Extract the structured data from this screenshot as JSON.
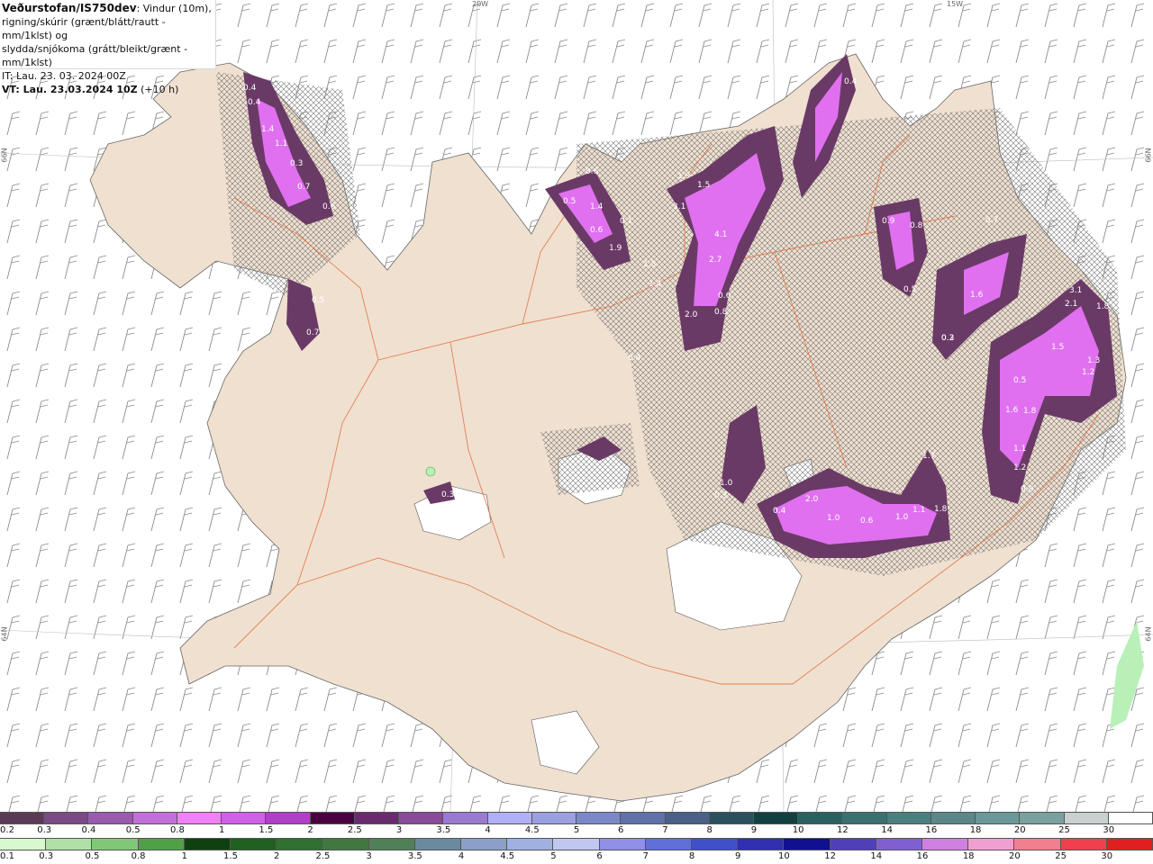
{
  "header": {
    "title": "Veðurstofan/IS750dev",
    "desc_line1": ": Vindur (10m),",
    "desc_line2": "rigning/skúrir (grænt/blátt/rautt - mm/1klst) og",
    "desc_line3": "slydda/snjókoma (grátt/bleikt/grænt - mm/1klst)",
    "it_line": "IT: Lau. 23. 03. 2024 00Z",
    "vt_bold": "VT: Lau. 23.03.2024 10Z",
    "vt_offset": " (+10 h)"
  },
  "grid_labels": {
    "top_20w": "20W",
    "top_15w": "15W",
    "left_66n": "66N",
    "left_64n": "64N",
    "right_66n": "66N",
    "right_64n": "64N"
  },
  "colors": {
    "land": "#f0e0d0",
    "glacier": "#ffffff",
    "roads": "#e07040",
    "snow_dark": "#6a3a66",
    "snow_mid": "#a050b0",
    "snow_light": "#e070f0",
    "rain_light": "#b8f0b8"
  },
  "precip_labels": [
    "0.4",
    "0.4",
    "1.4",
    "1.1",
    "0.3",
    "0.7",
    "0.6",
    "0.5",
    "0.7",
    "0.3",
    "0.6",
    "0.5",
    "1.4",
    "0.6",
    "1.9",
    "0.1",
    "1.5",
    "1.4",
    "0.4",
    "0.4",
    "1.5",
    "1.9",
    "1.5",
    "3.1",
    "4.1",
    "2.7",
    "0.6",
    "0.8",
    "2.0",
    "0.2",
    "0.9",
    "0.8",
    "0.5",
    "0.7",
    "1.6",
    "0.3",
    "3.1",
    "2.1",
    "1.8",
    "1.5",
    "1.3",
    "1.2",
    "0.5",
    "1.6",
    "1.1",
    "1.8",
    "1.2",
    "0.8",
    "1.0",
    "0.4",
    "2.0",
    "1.0",
    "0.6",
    "1.0",
    "1.1",
    "1.8",
    "1.7",
    "0.3"
  ],
  "legend_snow": {
    "labels": [
      "0.2",
      "0.3",
      "0.4",
      "0.5",
      "0.8",
      "1",
      "1.5",
      "2",
      "2.5",
      "3",
      "3.5",
      "4",
      "4.5",
      "5",
      "6",
      "7",
      "8",
      "9",
      "10",
      "12",
      "14",
      "16",
      "18",
      "20",
      "25",
      "30"
    ],
    "colors": [
      "#5a3a56",
      "#7a4a86",
      "#9a5aae",
      "#c070d8",
      "#f080f8",
      "#d060e8",
      "#b040c8",
      "#4a0040",
      "#6a2a70",
      "#8a4a9a",
      "#9a7ad0",
      "#b0b0f8",
      "#9aa0e0",
      "#7a88c8",
      "#6070a8",
      "#4a6088",
      "#2a5060",
      "#104040",
      "#2a6060",
      "#3a7070",
      "#4a8080",
      "#5a8888",
      "#6a9898",
      "#7aa0a0",
      "#c8d0d0",
      "#ffffff"
    ]
  },
  "legend_rain": {
    "labels": [
      "0.1",
      "0.3",
      "0.5",
      "0.8",
      "1",
      "1.5",
      "2",
      "2.5",
      "3",
      "3.5",
      "4",
      "4.5",
      "5",
      "6",
      "7",
      "8",
      "9",
      "10",
      "12",
      "14",
      "16",
      "18",
      "20",
      "25",
      "30"
    ],
    "colors": [
      "#d8f8d0",
      "#b0e0a8",
      "#80c878",
      "#50a048",
      "#104010",
      "#206020",
      "#307030",
      "#407840",
      "#508058",
      "#6a8aa0",
      "#8aa0c8",
      "#a0b0e0",
      "#c0c8f0",
      "#9090e8",
      "#6070d8",
      "#4050c8",
      "#3030b0",
      "#101090",
      "#5040b8",
      "#8060d0",
      "#d080e0",
      "#f0a0d0",
      "#f08090",
      "#f04050",
      "#e02020"
    ]
  }
}
